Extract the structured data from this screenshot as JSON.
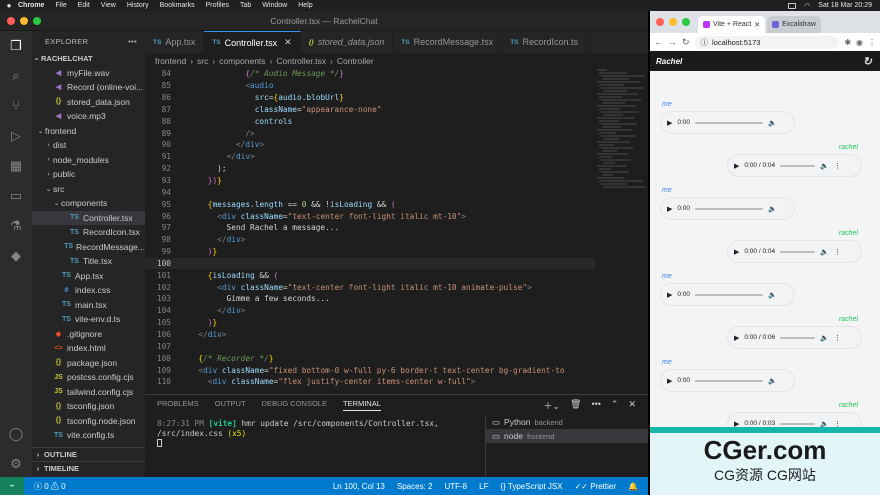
{
  "menubar": {
    "items": [
      "Chrome",
      "File",
      "Edit",
      "View",
      "History",
      "Bookmarks",
      "Profiles",
      "Tab",
      "Window",
      "Help"
    ],
    "clock": "Sat 18 Mar  20:29"
  },
  "vscode": {
    "title": "Controller.tsx — RachelChat",
    "explorer": {
      "header": "EXPLORER",
      "project": "RACHELCHAT",
      "items": [
        {
          "label": "myFile.wav",
          "icon": "audio-icon",
          "depth": 1,
          "folder": false
        },
        {
          "label": "Record (online-voi...",
          "icon": "audio-icon",
          "depth": 1,
          "folder": false
        },
        {
          "label": "stored_data.json",
          "icon": "json-icon",
          "depth": 1,
          "folder": false
        },
        {
          "label": "voice.mp3",
          "icon": "audio-icon",
          "depth": 1,
          "folder": false
        },
        {
          "label": "frontend",
          "icon": "folder-icon",
          "depth": 0,
          "folder": true
        },
        {
          "label": "dist",
          "icon": "folder-icon",
          "depth": 1,
          "folder": true
        },
        {
          "label": "node_modules",
          "icon": "folder-icon",
          "depth": 1,
          "folder": true
        },
        {
          "label": "public",
          "icon": "folder-icon",
          "depth": 1,
          "folder": true
        },
        {
          "label": "src",
          "icon": "folder-icon",
          "depth": 1,
          "folder": true
        },
        {
          "label": "components",
          "icon": "folder-icon",
          "depth": 2,
          "folder": true
        },
        {
          "label": "Controller.tsx",
          "icon": "ts-icon",
          "depth": 3,
          "folder": false,
          "selected": true
        },
        {
          "label": "RecordIcon.tsx",
          "icon": "ts-icon",
          "depth": 3,
          "folder": false
        },
        {
          "label": "RecordMessage...",
          "icon": "ts-icon",
          "depth": 3,
          "folder": false
        },
        {
          "label": "Title.tsx",
          "icon": "ts-icon",
          "depth": 3,
          "folder": false
        },
        {
          "label": "App.tsx",
          "icon": "ts-icon",
          "depth": 2,
          "folder": false
        },
        {
          "label": "index.css",
          "icon": "css-icon",
          "depth": 2,
          "folder": false
        },
        {
          "label": "main.tsx",
          "icon": "ts-icon",
          "depth": 2,
          "folder": false
        },
        {
          "label": "vite-env.d.ts",
          "icon": "ts-icon",
          "depth": 2,
          "folder": false
        },
        {
          "label": ".gitignore",
          "icon": "git-icon",
          "depth": 1,
          "folder": false
        },
        {
          "label": "index.html",
          "icon": "html-icon",
          "depth": 1,
          "folder": false
        },
        {
          "label": "package.json",
          "icon": "json-icon",
          "depth": 1,
          "folder": false
        },
        {
          "label": "postcss.config.cjs",
          "icon": "js-icon",
          "depth": 1,
          "folder": false
        },
        {
          "label": "tailwind.config.cjs",
          "icon": "js-icon",
          "depth": 1,
          "folder": false
        },
        {
          "label": "tsconfig.json",
          "icon": "json-icon",
          "depth": 1,
          "folder": false
        },
        {
          "label": "tsconfig.node.json",
          "icon": "json-icon",
          "depth": 1,
          "folder": false
        },
        {
          "label": "vite.config.ts",
          "icon": "ts-icon",
          "depth": 1,
          "folder": false
        }
      ],
      "outline": "OUTLINE",
      "timeline": "TIMELINE"
    },
    "tabs": [
      {
        "label": "App.tsx",
        "type": "TS",
        "active": false,
        "italic": false
      },
      {
        "label": "Controller.tsx",
        "type": "TS",
        "active": true,
        "italic": false
      },
      {
        "label": "stored_data.json",
        "type": "{}",
        "active": false,
        "italic": true
      },
      {
        "label": "RecordMessage.tsx",
        "type": "TS",
        "active": false,
        "italic": false
      },
      {
        "label": "RecordIcon.ts",
        "type": "TS",
        "active": false,
        "italic": false
      }
    ],
    "breadcrumb": [
      "frontend",
      "src",
      "components",
      "Controller.tsx",
      "Controller"
    ],
    "code": [
      {
        "n": "84",
        "html": "            <span class=\"c-brace2\">{</span><span class=\"c-com\">/* Audio Message */</span><span class=\"c-brace2\">}</span>"
      },
      {
        "n": "85",
        "html": "            <span class=\"c-gray\">&lt;</span><span class=\"c-tag\">audio</span>"
      },
      {
        "n": "86",
        "html": "              <span class=\"c-attr\">src</span>=<span class=\"c-brace\">{</span><span class=\"c-var\">audio</span>.<span class=\"c-var\">blobUrl</span><span class=\"c-brace\">}</span>"
      },
      {
        "n": "87",
        "html": "              <span class=\"c-attr\">className</span>=<span class=\"c-str\">\"appearance-none\"</span>"
      },
      {
        "n": "88",
        "html": "              <span class=\"c-attr\">controls</span>"
      },
      {
        "n": "89",
        "html": "            <span class=\"c-gray\">/&gt;</span>"
      },
      {
        "n": "90",
        "html": "          <span class=\"c-gray\">&lt;/</span><span class=\"c-tag\">div</span><span class=\"c-gray\">&gt;</span>"
      },
      {
        "n": "91",
        "html": "        <span class=\"c-gray\">&lt;/</span><span class=\"c-tag\">div</span><span class=\"c-gray\">&gt;</span>"
      },
      {
        "n": "92",
        "html": "      );"
      },
      {
        "n": "93",
        "html": "    <span class=\"c-brace2\">})</span><span class=\"c-brace\">}</span>"
      },
      {
        "n": "94",
        "html": ""
      },
      {
        "n": "95",
        "html": "    <span class=\"c-brace\">{</span><span class=\"c-var\">messages</span>.<span class=\"c-var\">length</span> == <span class=\"c-num\">0</span> &amp;&amp; !<span class=\"c-var\">isLoading</span> &amp;&amp; <span class=\"c-brace2\">(</span>"
      },
      {
        "n": "96",
        "html": "      <span class=\"c-gray\">&lt;</span><span class=\"c-tag\">div</span> <span class=\"c-attr\">className</span>=<span class=\"c-str\">\"text-center font-light italic mt-10\"</span><span class=\"c-gray\">&gt;</span>"
      },
      {
        "n": "97",
        "html": "        Send Rachel a message..."
      },
      {
        "n": "98",
        "html": "      <span class=\"c-gray\">&lt;/</span><span class=\"c-tag\">div</span><span class=\"c-gray\">&gt;</span>"
      },
      {
        "n": "99",
        "html": "    <span class=\"c-brace2\">)</span><span class=\"c-brace\">}</span>"
      },
      {
        "n": "100",
        "html": "",
        "current": true
      },
      {
        "n": "101",
        "html": "    <span class=\"c-brace\">{</span><span class=\"c-var\">isLoading</span> &amp;&amp; <span class=\"c-brace2\">(</span>"
      },
      {
        "n": "102",
        "html": "      <span class=\"c-gray\">&lt;</span><span class=\"c-tag\">div</span> <span class=\"c-attr\">className</span>=<span class=\"c-str\">\"text-center font-light italic mt-10 animate-pulse\"</span><span class=\"c-gray\">&gt;</span>"
      },
      {
        "n": "103",
        "html": "        Gimme a few seconds..."
      },
      {
        "n": "104",
        "html": "      <span class=\"c-gray\">&lt;/</span><span class=\"c-tag\">div</span><span class=\"c-gray\">&gt;</span>"
      },
      {
        "n": "105",
        "html": "    <span class=\"c-brace2\">)</span><span class=\"c-brace\">}</span>"
      },
      {
        "n": "106",
        "html": "  <span class=\"c-gray\">&lt;/</span><span class=\"c-tag\">div</span><span class=\"c-gray\">&gt;</span>"
      },
      {
        "n": "107",
        "html": ""
      },
      {
        "n": "108",
        "html": "  <span class=\"c-brace\">{</span><span class=\"c-com\">/* Recorder */</span><span class=\"c-brace\">}</span>"
      },
      {
        "n": "109",
        "html": "  <span class=\"c-gray\">&lt;</span><span class=\"c-tag\">div</span> <span class=\"c-attr\">className</span>=<span class=\"c-str\">\"fixed bottom-0 w-full py-6 border-t text-center bg-gradient-to</span>"
      },
      {
        "n": "110",
        "html": "    <span class=\"c-gray\">&lt;</span><span class=\"c-tag\">div</span> <span class=\"c-attr\">className</span>=<span class=\"c-str\">\"flex justify-center items-center w-full\"</span><span class=\"c-gray\">&gt;</span>"
      }
    ],
    "panel": {
      "tabs": [
        "PROBLEMS",
        "OUTPUT",
        "DEBUG CONSOLE",
        "TERMINAL"
      ],
      "active_tab": "TERMINAL",
      "terminal": {
        "time": "8:27:31 PM",
        "tag": "[vite]",
        "msg": "hmr update /src/components/Controller.tsx, /src/index.css",
        "count": "(x5)"
      },
      "terminals": [
        {
          "name": "Python",
          "sub": "backend",
          "selected": false
        },
        {
          "name": "node",
          "sub": "frontend",
          "selected": true
        }
      ]
    },
    "status": {
      "errors": "0",
      "warnings": "0",
      "position": "Ln 100, Col 13",
      "spaces": "Spaces: 2",
      "encoding": "UTF-8",
      "eol": "LF",
      "language": "TypeScript JSX",
      "prettier": "Prettier"
    }
  },
  "chrome": {
    "tabs": [
      "Vite + React",
      "Excalidraw"
    ],
    "url": "localhost:5173",
    "app_title": "Rachel",
    "messages": [
      {
        "sender": "me",
        "time": "0:00"
      },
      {
        "sender": "rachel",
        "time": "0:00 / 0:04"
      },
      {
        "sender": "me",
        "time": "0:00"
      },
      {
        "sender": "rachel",
        "time": "0:00 / 0:04"
      },
      {
        "sender": "me",
        "time": "0:00"
      },
      {
        "sender": "rachel",
        "time": "0:00 / 0:06"
      },
      {
        "sender": "me",
        "time": "0:00"
      },
      {
        "sender": "rachel",
        "time": "0:00 / 0:03"
      }
    ]
  },
  "watermark": {
    "line1": "CGer.com",
    "line2": "CG资源 CG网站"
  },
  "colors": {
    "accent": "#007acc",
    "me_label": "#3b82f6",
    "rachel_label": "#22c55e"
  }
}
